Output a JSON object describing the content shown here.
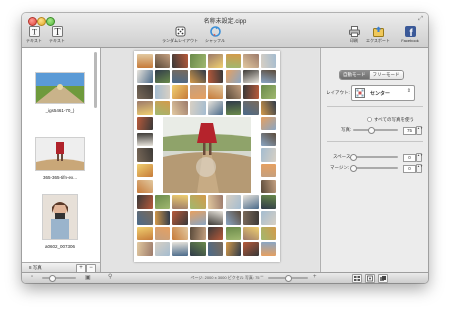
{
  "window": {
    "title": "名称未設定.cipp"
  },
  "toolbar": {
    "left_buttons": [
      {
        "label": "テキスト"
      },
      {
        "label": "テキスト"
      }
    ],
    "center_buttons": [
      {
        "label": "ランダムレイアウト"
      },
      {
        "label": "シャッフル"
      }
    ],
    "right_buttons": [
      {
        "label": "印刷"
      },
      {
        "label": "エクスポート"
      },
      {
        "label": "Facebook"
      }
    ]
  },
  "photo_list": {
    "items": [
      {
        "label": "_igs5461-70_)"
      },
      {
        "label": "365-365-tifn-ex..."
      },
      {
        "label": "a0602_007306"
      }
    ],
    "footer_label": "8 写真",
    "add_label": "+",
    "remove_label": "−"
  },
  "inspector": {
    "segments": [
      "自動モード",
      "フリーモード"
    ],
    "active_segment": 0,
    "layout_label": "レイアウト:",
    "layout_value": "センター",
    "use_all_photos": "すべての写真を使う",
    "photos_label": "写真:",
    "photos_value": "75",
    "photos_level": 0.4,
    "space_label": "スペース:",
    "space_value": "0",
    "space_level": 0.0,
    "margin_label": "マージン:",
    "margin_value": "0",
    "margin_level": 0.0
  },
  "status": {
    "text": "ページ: 2000 x 3000 ピクセル 写真: 75",
    "zoom_level": 0.3,
    "page_zoom_level": 0.5
  },
  "colors": {
    "toolbar_top": "#ececec",
    "toolbar_bottom": "#cfcfcf",
    "segment_active": "#7a7a7a"
  }
}
